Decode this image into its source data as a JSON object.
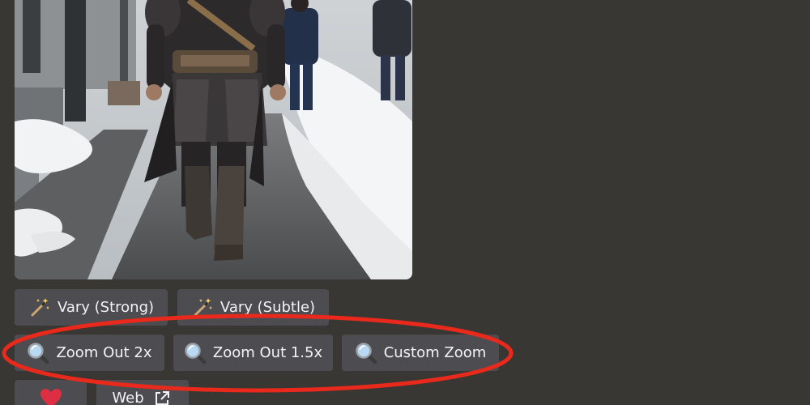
{
  "message": {
    "image": {
      "icon": "image-attachment"
    },
    "buttons_row1": [
      {
        "label": "Vary (Strong)",
        "icon": "magic-wand-icon"
      },
      {
        "label": "Vary (Subtle)",
        "icon": "magic-wand-icon"
      }
    ],
    "buttons_row2": [
      {
        "label": "Zoom Out 2x",
        "icon": "magnifier-icon"
      },
      {
        "label": "Zoom Out 1.5x",
        "icon": "magnifier-icon"
      },
      {
        "label": "Custom Zoom",
        "icon": "magnifier-icon"
      }
    ],
    "buttons_row3": [
      {
        "label": "",
        "icon": "heart-icon"
      },
      {
        "label": "Web",
        "icon": "external-link-icon"
      }
    ]
  },
  "annotation": {
    "color": "#e8291c"
  },
  "colors": {
    "background": "#393733",
    "button": "#4d4c51",
    "button_text": "#f2f3f5"
  }
}
